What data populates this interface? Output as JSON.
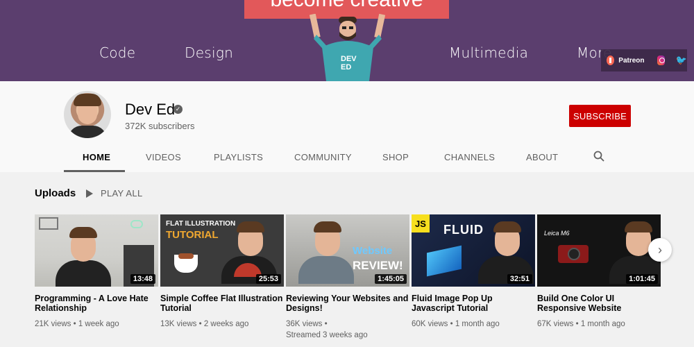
{
  "banner": {
    "sign_text": "become creative",
    "links": [
      "Code",
      "Design",
      "Multimedia",
      "More"
    ],
    "mascot_label": "DEV ED",
    "social": {
      "patreon_label": "Patreon",
      "instagram_icon": "instagram-icon",
      "twitter_icon": "twitter-icon"
    }
  },
  "channel": {
    "name": "Dev Ed",
    "subscribers": "372K subscribers",
    "subscribe_label": "SUBSCRIBE",
    "accent_color": "#cc0000"
  },
  "tabs": [
    "HOME",
    "VIDEOS",
    "PLAYLISTS",
    "COMMUNITY",
    "SHOP",
    "CHANNELS",
    "ABOUT"
  ],
  "active_tab": "HOME",
  "uploads": {
    "title": "Uploads",
    "play_all_label": "PLAY ALL",
    "videos": [
      {
        "title": "Programming - A Love Hate Relationship",
        "duration": "13:48",
        "views": "21K views",
        "age": "1 week ago",
        "meta": "21K views • 1 week ago",
        "extra": ""
      },
      {
        "title": "Simple Coffee Flat Illustration Tutorial",
        "duration": "25:53",
        "views": "13K views",
        "age": "2 weeks ago",
        "meta": "13K views • 2 weeks ago",
        "extra": "",
        "thumb_text_1": "FLAT ILLUSTRATION",
        "thumb_text_2": "TUTORIAL"
      },
      {
        "title": "Reviewing Your Websites and Designs!",
        "duration": "1:45:05",
        "views": "36K views",
        "age": "Streamed 3 weeks ago",
        "meta": "36K views •",
        "extra": "Streamed 3 weeks ago",
        "thumb_text_1": "Website",
        "thumb_text_2": "REVIEW!"
      },
      {
        "title": "Fluid Image Pop Up Javascript Tutorial",
        "duration": "32:51",
        "views": "60K views",
        "age": "1 month ago",
        "meta": "60K views • 1 month ago",
        "extra": "",
        "thumb_text_1": "JS",
        "thumb_text_2": "FLUID"
      },
      {
        "title": "Build One Color UI Responsive Website Tutoria…",
        "duration": "1:01:45",
        "views": "67K views",
        "age": "1 month ago",
        "meta": "67K views • 1 month ago",
        "extra": "",
        "thumb_text_1": "Leica M6"
      }
    ]
  }
}
